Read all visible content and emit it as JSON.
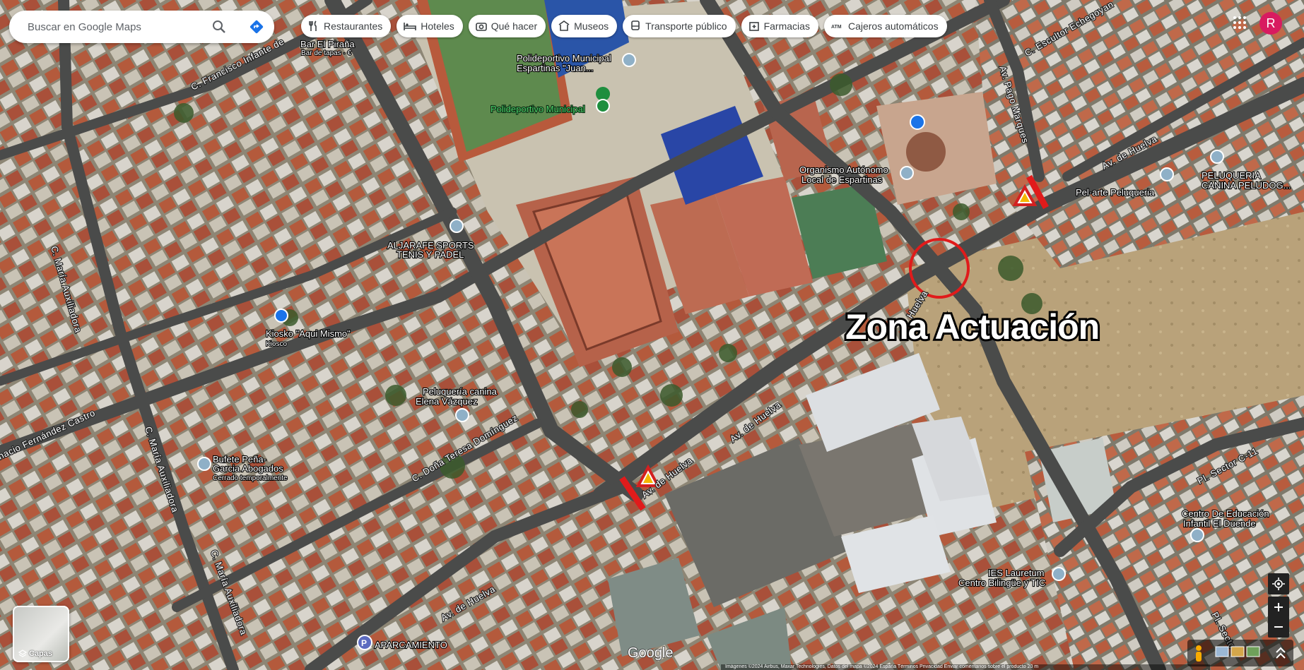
{
  "search": {
    "placeholder": "Buscar en Google Maps"
  },
  "chips": [
    {
      "label": "Restaurantes",
      "icon": "fork-knife-icon"
    },
    {
      "label": "Hoteles",
      "icon": "bed-icon"
    },
    {
      "label": "Qué hacer",
      "icon": "camera-icon"
    },
    {
      "label": "Museos",
      "icon": "museum-icon"
    },
    {
      "label": "Transporte público",
      "icon": "bus-icon"
    },
    {
      "label": "Farmacias",
      "icon": "pharmacy-icon"
    },
    {
      "label": "Cajeros automáticos",
      "icon": "atm-icon"
    }
  ],
  "account": {
    "initial": "R"
  },
  "layers": {
    "label": "Capas"
  },
  "annotation": {
    "zone_label": "Zona Actuación"
  },
  "places": {
    "bar": "Bar El Piraña",
    "bar_sub": "Bar de tapas · €",
    "polideportivo": "Polideportivo Municipal",
    "polideportivo_2": "Espartinas \"Juan...",
    "polideportivo_green": "Polideportivo Municipal",
    "organismo_1": "Organismo Autónomo",
    "organismo_2": "Local de Espartinas",
    "peluqueria_canina_1": "PELUQUERIA",
    "peluqueria_canina_2": "CANINA PELUDOG...",
    "pelarte": "Pel·arte Peluqueria",
    "aljarafe_1": "ALJARAFE SPORTS",
    "aljarafe_2": "TENIS Y PADEL",
    "kiosko": "Kiosko \"Aqui Mismo\"",
    "kiosko_sub": "Kiosco",
    "peluqueria_elena_1": "Peluquería canina",
    "peluqueria_elena_2": "Elena Vázquez",
    "bufete_1": "Bufete Peña-",
    "bufete_2": "Garcia Abogados",
    "bufete_sub": "Cerrado temporalmente",
    "centro_1": "Centro De Educación",
    "centro_2": "Infantil El Duende",
    "ies_1": "IES Lauretum",
    "ies_2": "Centro Bilingüe y TIC",
    "aparcamiento": "APARCAMIENTO"
  },
  "streets": {
    "francisco_infante": "C. Francisco Infante de",
    "maria_aux_1": "C. María Auxiliadora",
    "maria_aux_2": "C. María Auxiliadora",
    "maria_aux_3": "C. María Auxiliadora",
    "ignacio": "nacio Fernández Castro",
    "dona_teresa": "C. Doña Teresa Domínguez",
    "huelva_1": "Av. de Huelva",
    "huelva_2": "Av. de Huelva",
    "huelva_3": "Av. de Huelva",
    "huelva_4": "Av. de Huelva",
    "huelva_5": "Huelva",
    "pago_marques": "Av. Pago Marques",
    "escultor": "C. Escultor Echegoyan",
    "sector_c11": "Pl. Sector C-11",
    "sector_2": "Pl. Secto"
  },
  "branding": {
    "google": "Google"
  },
  "footer": {
    "attribution": "Imágenes ©2024 Airbus, Maxar Technologies, Datos del mapa ©2024   España   Términos   Privacidad   Enviar comentarios sobre el producto   20 m"
  }
}
